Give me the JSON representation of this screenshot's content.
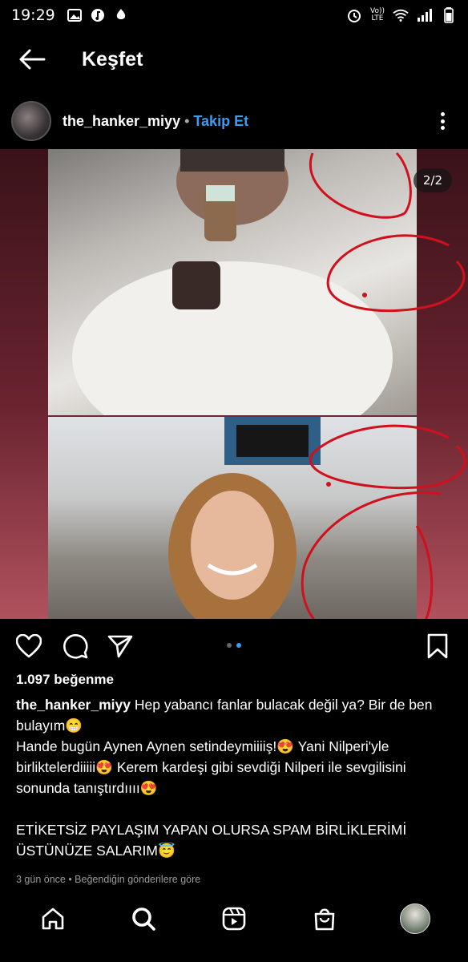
{
  "status": {
    "time": "19:29",
    "lte_top": "Vo))",
    "lte_bottom": "LTE"
  },
  "header": {
    "title": "Keşfet"
  },
  "post": {
    "username": "the_hanker_miyy",
    "separator": "•",
    "follow_label": "Takip Et",
    "counter": "2/2",
    "likes": "1.097 beğenme",
    "caption_user": "the_hanker_miyy",
    "caption_lines": [
      "Hep yabancı fanlar bulacak değil ya? Bir de ben bulayım😁",
      "Hande bugün Aynen Aynen setindeymiiiiş!😍 Yani Nilperi'yle birliktelerdiiiii😍 Kerem kardeşi gibi sevdiği Nilperi ile sevgilisini sonunda tanıştırdıııı😍",
      "ETİKETSİZ PAYLAŞIM YAPAN OLURSA SPAM BİRLİKLERİMİ ÜSTÜNÜZE SALARIM😇"
    ],
    "meta": "3 gün önce • Beğendiğin gönderilere göre"
  },
  "colors": {
    "accent": "#3b9cf0",
    "annotation": "#d0101c"
  }
}
